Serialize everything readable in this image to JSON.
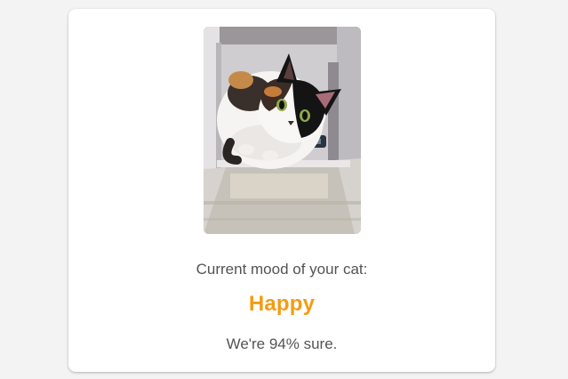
{
  "result": {
    "mood_label": "Current mood of your cat:",
    "mood_value": "Happy",
    "confidence_text": "We're 94% sure."
  },
  "photo": {
    "subject": "calico cat looking up",
    "icon": "cat-photo"
  },
  "colors": {
    "background": "#f3f3f3",
    "card": "#ffffff",
    "accent": "#f39c12",
    "text": "#545454"
  }
}
